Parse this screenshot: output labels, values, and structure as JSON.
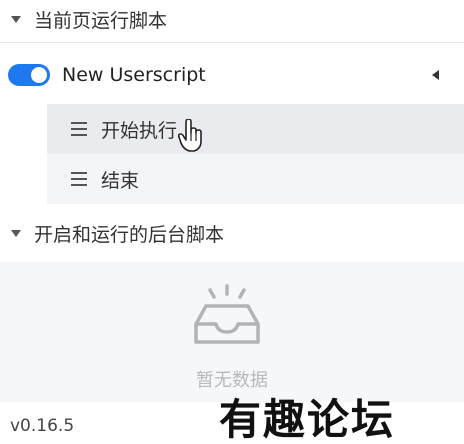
{
  "sections": {
    "current_page": {
      "title": "当前页运行脚本"
    },
    "background": {
      "title": "开启和运行的后台脚本"
    }
  },
  "script": {
    "name": "New Userscript",
    "enabled": true,
    "menu_items": [
      {
        "label": "开始执行"
      },
      {
        "label": "结束"
      }
    ]
  },
  "empty_state": {
    "text": "暂无数据",
    "icon": "empty-inbox-icon"
  },
  "version": "v0.16.5",
  "watermark": "有趣论坛",
  "colors": {
    "toggle_on": "#1e78f0",
    "menu_bg": "#f4f5f7",
    "empty_text": "#b7b9bd"
  }
}
